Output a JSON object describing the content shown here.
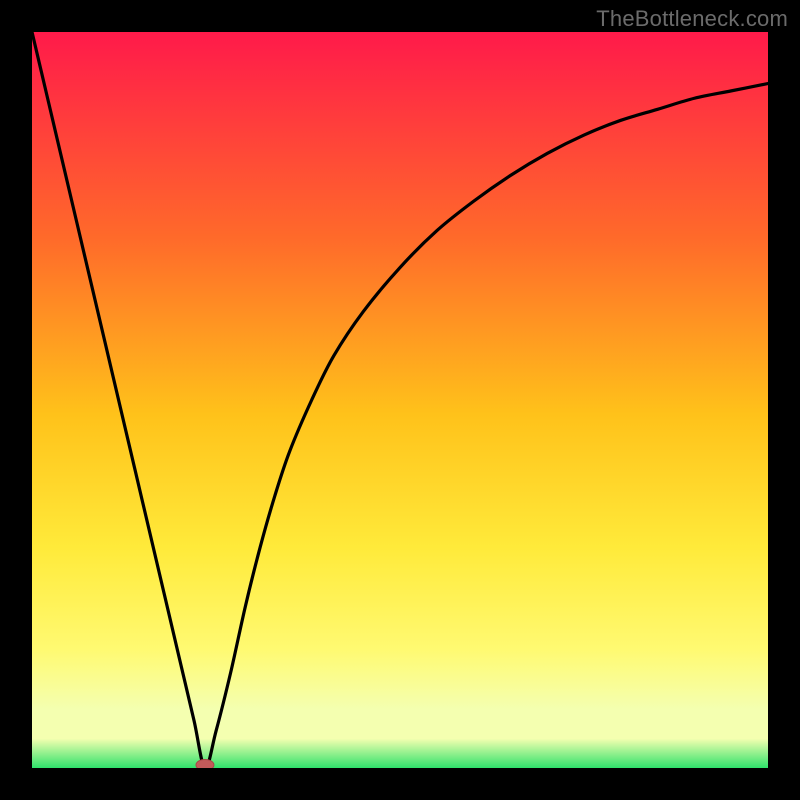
{
  "watermark": "TheBottleneck.com",
  "colors": {
    "frame": "#000000",
    "curve": "#000000",
    "marker_fill": "#c25a5a",
    "marker_stroke": "#a84646",
    "gradient": {
      "top": "#ff1a4a",
      "q1": "#ff6a2a",
      "mid": "#ffc21a",
      "q3": "#ffea3a",
      "low_yellow": "#fffa72",
      "pale": "#f4ffb0",
      "green": "#2fe26b"
    }
  },
  "chart_data": {
    "type": "line",
    "title": "",
    "xlabel": "",
    "ylabel": "",
    "xlim": [
      0,
      100
    ],
    "ylim": [
      0,
      100
    ],
    "series": [
      {
        "name": "bottleneck-curve",
        "x": [
          0,
          2,
          4,
          6,
          8,
          10,
          12,
          14,
          16,
          18,
          20,
          22,
          23.5,
          25,
          27,
          29,
          31,
          33,
          35,
          38,
          41,
          45,
          50,
          55,
          60,
          65,
          70,
          75,
          80,
          85,
          90,
          95,
          100
        ],
        "y": [
          100,
          91.5,
          83,
          74.5,
          66,
          57.5,
          49,
          40.5,
          32,
          23.5,
          15,
          6.5,
          0,
          5,
          13,
          22,
          30,
          37,
          43,
          50,
          56,
          62,
          68,
          73,
          77,
          80.5,
          83.5,
          86,
          88,
          89.5,
          91,
          92,
          93
        ]
      }
    ],
    "marker": {
      "x": 23.5,
      "y": 0
    },
    "gradient_stops_pct": [
      0,
      28,
      52,
      70,
      84,
      92,
      96,
      100
    ],
    "green_band_fraction": 0.04
  }
}
